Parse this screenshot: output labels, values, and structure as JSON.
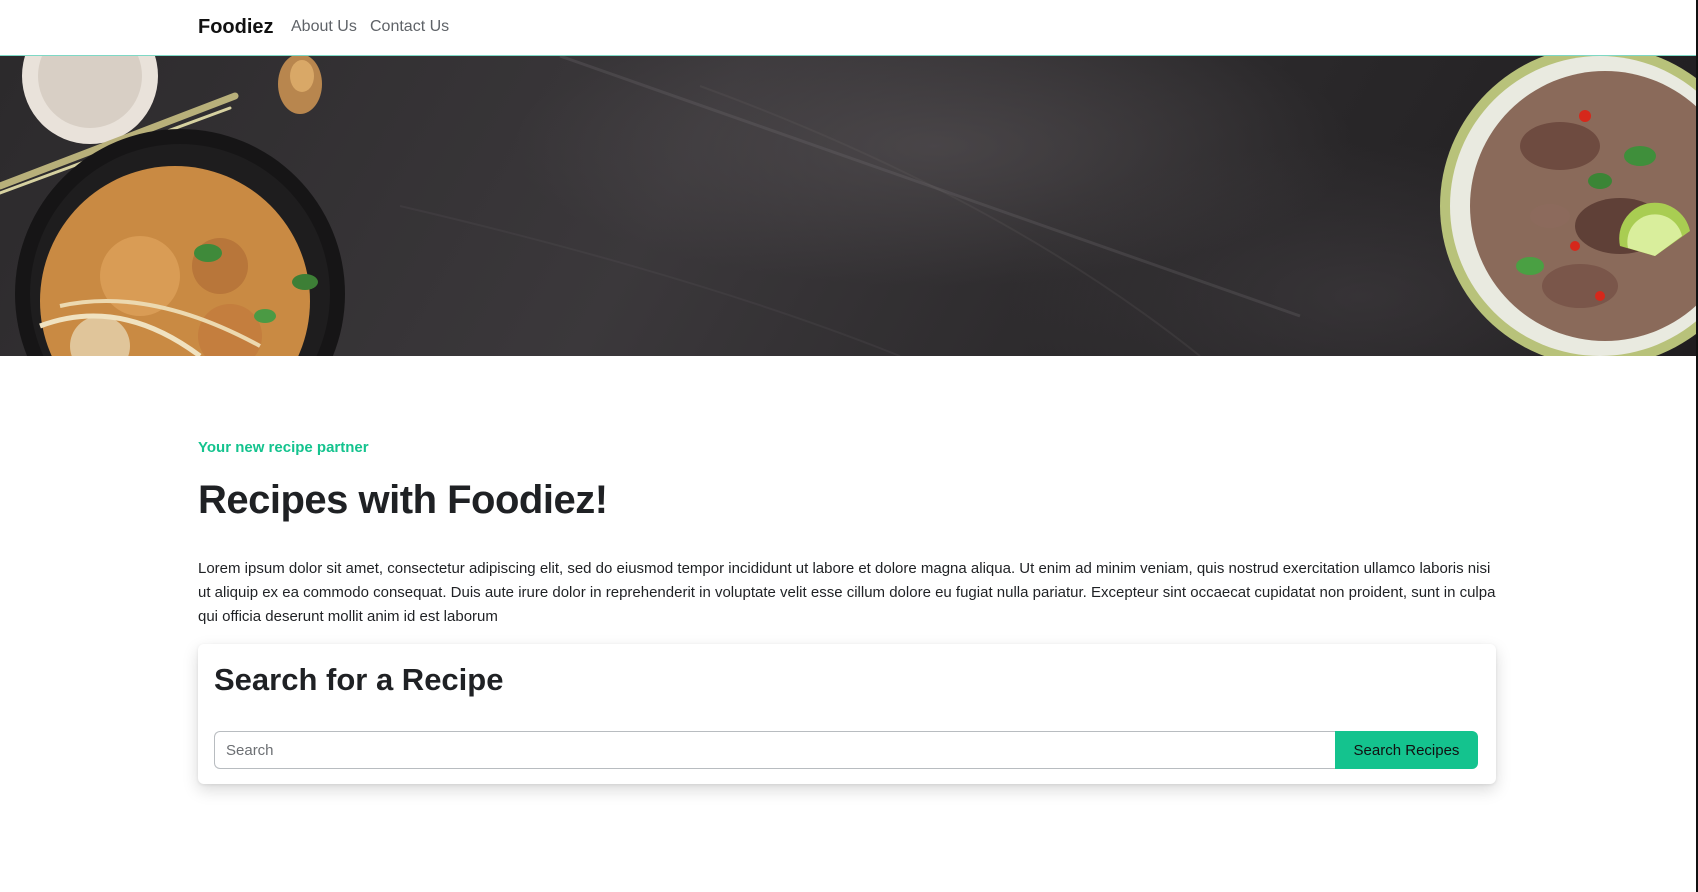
{
  "navbar": {
    "brand": "Foodiez",
    "links": [
      "About Us",
      "Contact Us"
    ]
  },
  "hero": {
    "image_description_icons": [
      "noodle-bowl-left",
      "soup-bowl-right"
    ]
  },
  "main": {
    "tagline": "Your new recipe partner",
    "title": "Recipes with Foodiez!",
    "lead": "Lorem ipsum dolor sit amet, consectetur adipiscing elit, sed do eiusmod tempor incididunt ut labore et dolore magna aliqua. Ut enim ad minim veniam, quis nostrud exercitation ullamco laboris nisi ut aliquip ex ea commodo consequat. Duis aute irure dolor in reprehenderit in voluptate velit esse cillum dolore eu fugiat nulla pariatur. Excepteur sint occaecat cupidatat non proident, sunt in culpa qui officia deserunt mollit anim id est laborum"
  },
  "search": {
    "title": "Search for a Recipe",
    "placeholder": "Search",
    "button_label": "Search Recipes"
  },
  "colors": {
    "accent": "#14c38e",
    "hero_bg": "#2c2a2c",
    "text": "#1f2124"
  }
}
